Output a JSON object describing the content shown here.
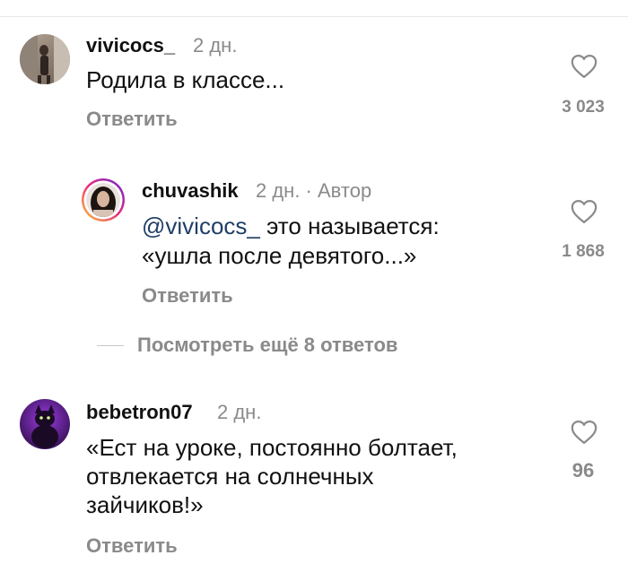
{
  "comments": [
    {
      "username": "vivicocs_",
      "time": "2 дн.",
      "text": "Родила в классе...",
      "reply_label": "Ответить",
      "likes": "3 023",
      "avatar_icon": "photo-avatar"
    },
    {
      "username": "chuvashik",
      "time": "2 дн. · Автор",
      "mention": "@vivicocs_",
      "text_line1": " это называется:",
      "text_line2": "«ушла после девятого...»",
      "reply_label": "Ответить",
      "likes": "1 868",
      "avatar_icon": "story-ring-avatar"
    },
    {
      "username": "bebetron07",
      "time": "2 дн.",
      "text_line1": "«Ест на уроке, постоянно болтает,",
      "text_line2": "отвлекается на солнечных",
      "text_line3": "зайчиков!»",
      "reply_label": "Ответить",
      "likes": "96",
      "avatar_icon": "cat-avatar"
    }
  ],
  "view_more_replies": "Посмотреть ещё 8 ответов",
  "icons": {
    "like": "heart-outline-icon"
  },
  "colors": {
    "mention": "#1f3f66",
    "muted": "#8a8a8a",
    "story_ring_start": "#f9ce34",
    "story_ring_end": "#ee2a7b"
  }
}
